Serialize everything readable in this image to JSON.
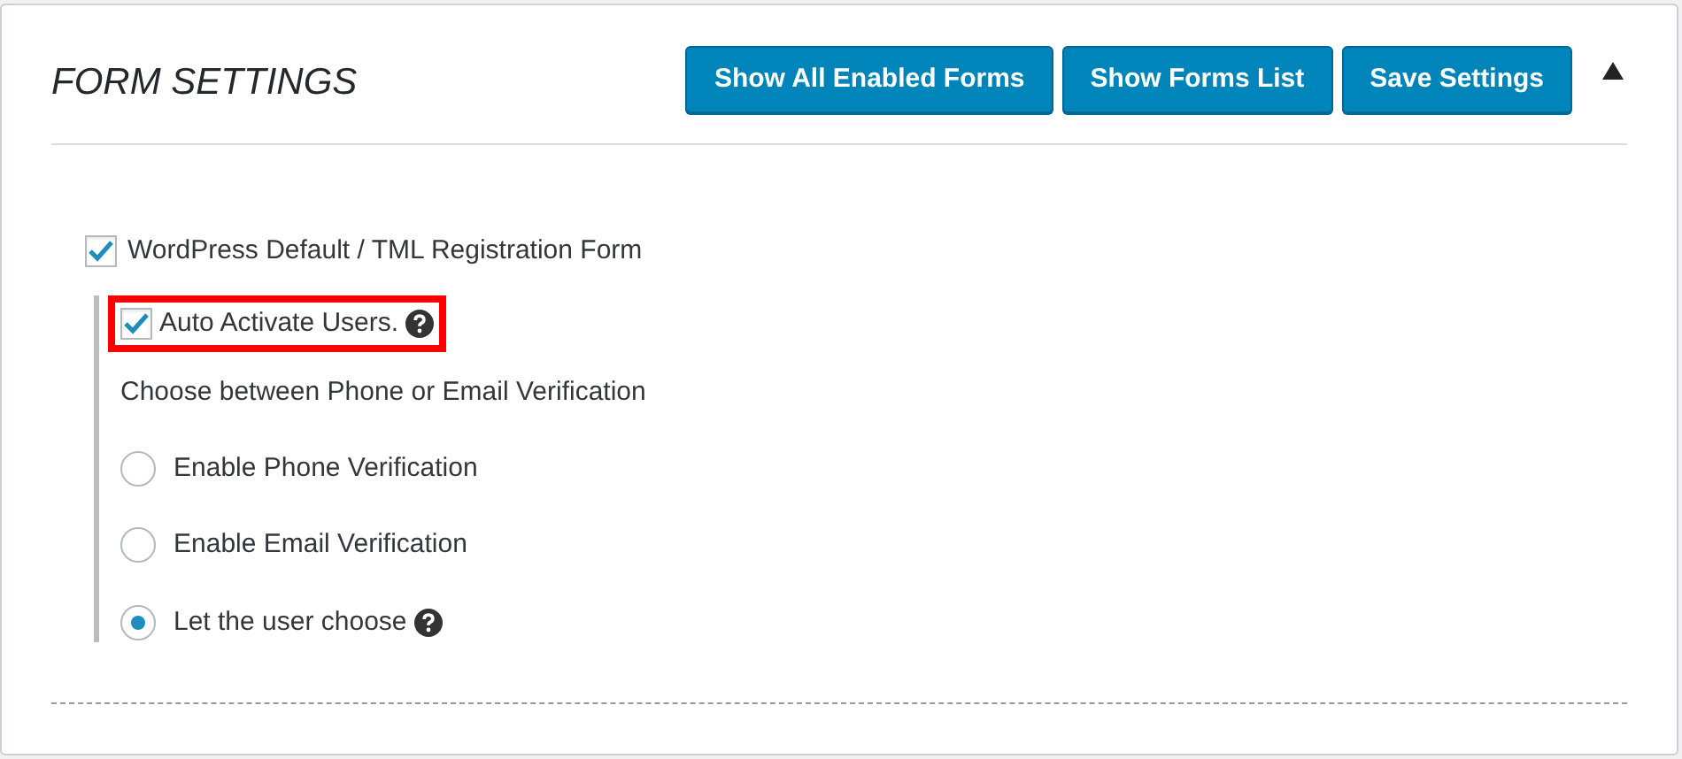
{
  "title": "FORM SETTINGS",
  "buttons": [
    "Show All Enabled Forms",
    "Show Forms List",
    "Save Settings"
  ],
  "collapse": {
    "expanded": true
  },
  "form": {
    "label": "WordPress Default / TML Registration Form",
    "checked": true
  },
  "auto_activate": {
    "label": "Auto Activate Users.",
    "checked": true,
    "highlighted": true,
    "help": true
  },
  "verification": {
    "prompt": "Choose between Phone or Email Verification",
    "options": [
      {
        "label": "Enable Phone Verification",
        "selected": false,
        "help": false
      },
      {
        "label": "Enable Email Verification",
        "selected": false,
        "help": false
      },
      {
        "label": "Let the user choose",
        "selected": true,
        "help": true
      }
    ]
  }
}
